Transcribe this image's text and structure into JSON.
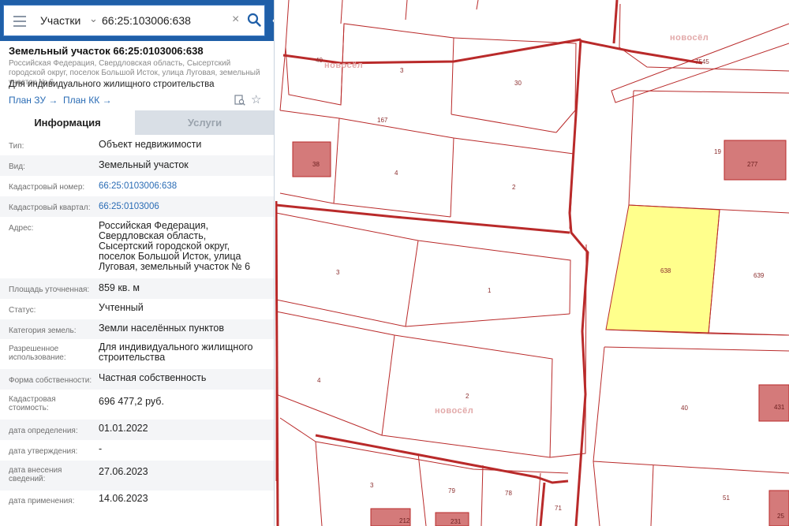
{
  "search": {
    "type": "Участки",
    "value": "66:25:103006:638"
  },
  "parcel": {
    "title": "Земельный участок 66:25:0103006:638",
    "address": "Российская Федерация, Свердловская область, Сысертский городской округ, поселок Большой Исток, улица Луговая, земельный участок № 6",
    "use": "Для индивидуального жилищного строительства",
    "link_zu": "План ЗУ →",
    "link_kk": "План КК →"
  },
  "tabs": {
    "info": "Информация",
    "services": "Услуги"
  },
  "properties": [
    {
      "label": "Тип:",
      "value": "Объект недвижимости"
    },
    {
      "label": "Вид:",
      "value": "Земельный участок"
    },
    {
      "label": "Кадастровый номер:",
      "value": "66:25:0103006:638"
    },
    {
      "label": "Кадастровый квартал:",
      "value": "66:25:0103006"
    },
    {
      "label": "Адрес:",
      "value": "Российская Федерация, Свердловская область, Сысертский городской округ, поселок Большой Исток, улица Луговая, земельный участок № 6"
    },
    {
      "label": "Площадь уточненная:",
      "value": "859 кв. м"
    },
    {
      "label": "Статус:",
      "value": "Учтенный"
    },
    {
      "label": "Категория земель:",
      "value": "Земли населённых пунктов"
    },
    {
      "label": "Разрешенное использование:",
      "value": "Для индивидуального жилищного строительства"
    },
    {
      "label": "Форма собственности:",
      "value": "Частная собственность"
    },
    {
      "label": "Кадастровая стоимость:",
      "value": "696 477,2 руб."
    },
    {
      "label": "дата определения:",
      "value": "01.01.2022"
    },
    {
      "label": "дата утверждения:",
      "value": "-"
    },
    {
      "label": "дата внесения сведений:",
      "value": "27.06.2023"
    },
    {
      "label": "дата применения:",
      "value": "14.06.2023"
    }
  ],
  "map": {
    "parcel_labels": [
      "40",
      "3",
      "30",
      "167",
      "38",
      "4",
      "2",
      "3",
      "1",
      "4",
      "2",
      "3",
      "79",
      "78",
      "71",
      "212",
      "231",
      "7545",
      "19",
      "277",
      "638",
      "639",
      "40",
      "431",
      "51",
      "25"
    ],
    "watermark": "новосёл",
    "colors": {
      "selected_parcel": "#ffff8c",
      "building": "#d47a7a",
      "boundary": "#b92a2a"
    }
  }
}
